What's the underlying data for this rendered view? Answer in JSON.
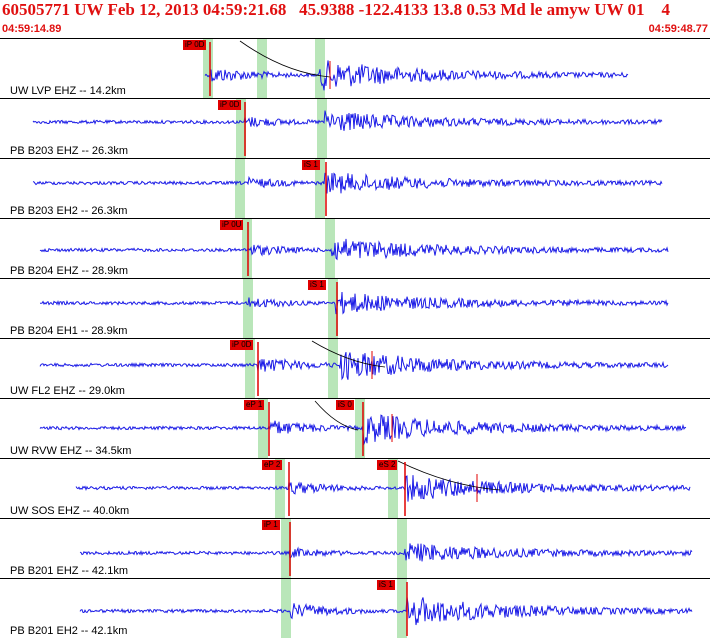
{
  "header": {
    "title": "60505771 UW Feb 12, 2013 04:59:21.68   45.9388 -122.4133 13.8 0.53 Md le amyw UW 01    4",
    "start_time": "04:59:14.89",
    "end_time": "04:59:48.77"
  },
  "colors": {
    "trace": "#1a1ae6",
    "pick": "#e00000",
    "window": "#b9e6b9",
    "header_text": "#e01010",
    "separator": "#000000"
  },
  "channels": [
    {
      "label": "UW LVP EHZ -- 14.2km",
      "picks": [
        {
          "label": "iP 0D"
        }
      ]
    },
    {
      "label": "PB B203 EHZ -- 26.3km",
      "picks": [
        {
          "label": "iP 0D"
        }
      ]
    },
    {
      "label": "PB B203 EH2 -- 26.3km",
      "picks": [
        {
          "label": "iS 1"
        }
      ]
    },
    {
      "label": "PB B204 EHZ -- 28.9km",
      "picks": [
        {
          "label": "iP 0U"
        }
      ]
    },
    {
      "label": "PB B204 EH1 -- 28.9km",
      "picks": [
        {
          "label": "iS 1"
        }
      ]
    },
    {
      "label": "UW FL2 EHZ -- 29.0km",
      "picks": [
        {
          "label": "iP 0D"
        }
      ]
    },
    {
      "label": "UW RVW EHZ -- 34.5km",
      "picks": [
        {
          "label": "eP 1"
        },
        {
          "label": "iS 0"
        }
      ]
    },
    {
      "label": "UW SOS EHZ -- 40.0km",
      "picks": [
        {
          "label": "eP 2"
        },
        {
          "label": "eS 2"
        }
      ]
    },
    {
      "label": "PB B201 EHZ -- 42.1km",
      "picks": [
        {
          "label": "iP 1"
        }
      ]
    },
    {
      "label": "PB B201 EH2 -- 42.1km",
      "picks": [
        {
          "label": "iS 1"
        }
      ]
    }
  ]
}
